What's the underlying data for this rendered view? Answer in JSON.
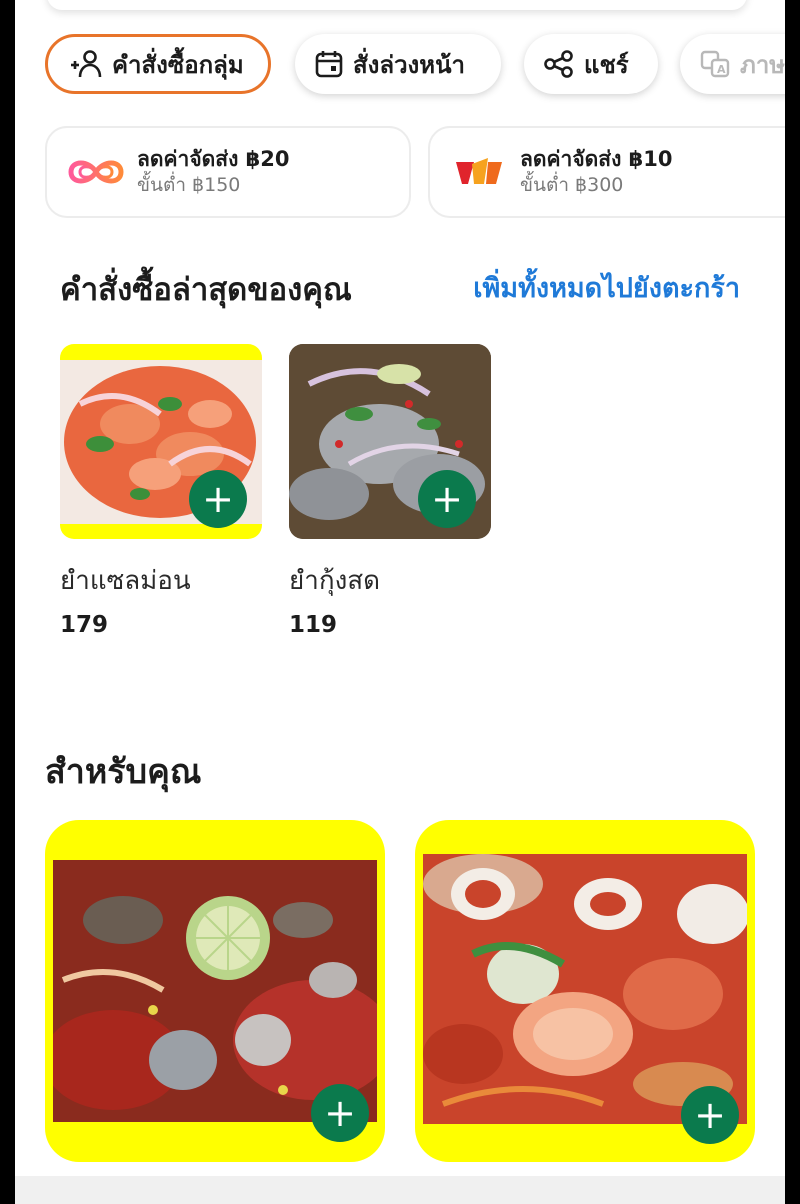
{
  "chips": [
    {
      "label": "คำสั่งซื้อกลุ่ม",
      "icon": "group-order-icon",
      "active": true
    },
    {
      "label": "สั่งล่วงหน้า",
      "icon": "calendar-icon",
      "active": false
    },
    {
      "label": "แชร์",
      "icon": "share-icon",
      "active": false
    },
    {
      "label": "ภาษ",
      "icon": "translate-icon",
      "active": false
    }
  ],
  "promos": [
    {
      "title": "ลดค่าจัดส่ง ฿20",
      "subtitle": "ขั้นต่ำ ฿150",
      "icon": "infinity-logo-icon"
    },
    {
      "title": "ลดค่าจัดส่ง ฿10",
      "subtitle": "ขั้นต่ำ ฿300",
      "icon": "wallet-logo-icon"
    }
  ],
  "recent": {
    "title": "คำสั่งซื้อล่าสุดของคุณ",
    "add_all_label": "เพิ่มทั้งหมดไปยังตะกร้า",
    "items": [
      {
        "name": "ยำแซลม่อน",
        "price": "179"
      },
      {
        "name": "ยำกุ้งสด",
        "price": "119"
      }
    ]
  },
  "for_you": {
    "title": "สำหรับคุณ",
    "items": [
      {
        "label": "seafood-salad-squid"
      },
      {
        "label": "seafood-salad-shrimp"
      }
    ]
  },
  "colors": {
    "accent_orange": "#e8742a",
    "link_blue": "#1f7ad8",
    "add_green": "#0b7a4d",
    "card_yellow": "#ffff00"
  }
}
